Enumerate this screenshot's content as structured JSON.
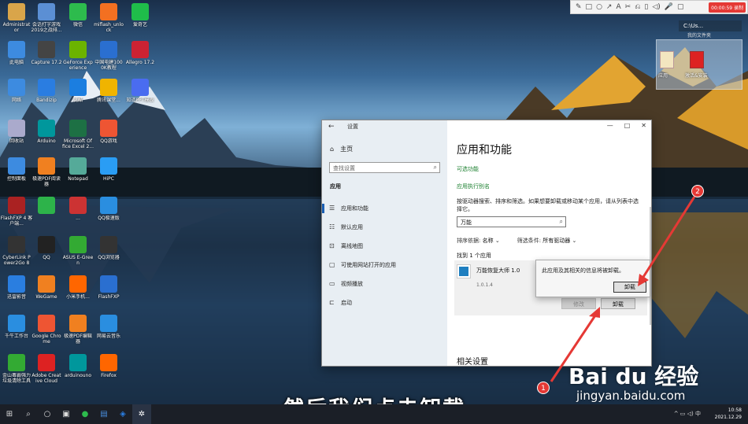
{
  "desktop": {
    "icons": [
      {
        "label": "Administrat or",
        "color": "#d9a54a"
      },
      {
        "label": "会话打字游戏 2019之战排...",
        "color": "#5b8fd4"
      },
      {
        "label": "微信",
        "color": "#2dbb4d"
      },
      {
        "label": "miflash_unlo ck",
        "color": "#f37021"
      },
      {
        "label": "爱奇艺",
        "color": "#1fbd4a"
      },
      {
        "label": "此电脑",
        "color": "#3d8be0"
      },
      {
        "label": "Capture 17.2",
        "color": "#444"
      },
      {
        "label": "GeForce Exp erience",
        "color": "#6bb300"
      },
      {
        "label": "中国电建100 0K教程",
        "color": "#2a6fd0"
      },
      {
        "label": "Allegro 17.2",
        "color": "#c23"
      },
      {
        "label": "网络",
        "color": "#3d8be0"
      },
      {
        "label": "Bandizip",
        "color": "#2a7de1"
      },
      {
        "label": "优酷",
        "color": "#1b7ee0"
      },
      {
        "label": "腾讯课堂...",
        "color": "#f0b400"
      },
      {
        "label": "知道PPT模板",
        "color": "#4a6cf0"
      },
      {
        "label": "回收站",
        "color": "#aac"
      },
      {
        "label": "Arduino",
        "color": "#00979c"
      },
      {
        "label": "Microsoft Of fice Excel 2...",
        "color": "#1d7044"
      },
      {
        "label": "QQ游戏",
        "color": "#e53"
      },
      {
        "label": "控制面板",
        "color": "#3d8be0"
      },
      {
        "label": "极速PDF阅读 器",
        "color": "#f08020"
      },
      {
        "label": "Notepad",
        "color": "#5a9"
      },
      {
        "label": "HiPC",
        "color": "#2a9df4"
      },
      {
        "label": "FlashFXP 4 客户端...",
        "color": "#a22"
      },
      {
        "label": "",
        "color": "#2db34a"
      },
      {
        "label": "...",
        "color": "#c33"
      },
      {
        "label": "QQ极速版",
        "color": "#2a8ee0"
      },
      {
        "label": "CyberLink P ower2Go 8",
        "color": "#333"
      },
      {
        "label": "QQ",
        "color": "#222"
      },
      {
        "label": "ASUS E-Gree n",
        "color": "#3a3"
      },
      {
        "label": "QQ浏览器",
        "color": "#333"
      },
      {
        "label": "迅雷影音",
        "color": "#2a7ee0"
      },
      {
        "label": "WeGame",
        "color": "#f08020"
      },
      {
        "label": "小米手机...",
        "color": "#f60"
      },
      {
        "label": "FlashFXP",
        "color": "#2a6fd0"
      },
      {
        "label": "千牛工作台",
        "color": "#2a8ee0"
      },
      {
        "label": "Google Chro me",
        "color": "#e53"
      },
      {
        "label": "极速PDF编辑 器",
        "color": "#f08020"
      },
      {
        "label": "网易云音乐",
        "color": "#2a8ee0"
      },
      {
        "label": "金山毒霸强力 垃圾清除工具",
        "color": "#3a3"
      },
      {
        "label": "Adobe Creat ive Cloud",
        "color": "#d22"
      },
      {
        "label": "arduinouno",
        "color": "#00979c"
      },
      {
        "label": "Firefox",
        "color": "#f60"
      }
    ],
    "folder_label": "我的文件夹",
    "folder_items": [
      "应用",
      "激活&安装"
    ],
    "top_right_label": "C:\\Us..."
  },
  "recorder": {
    "tools": [
      "✎",
      "□",
      "○",
      "↗",
      "A",
      "✂",
      "⎌",
      "▯",
      "◁)",
      "🎤",
      "▢"
    ],
    "rec_label": "00:00:59 录制"
  },
  "settings": {
    "title": "设置",
    "back": "←",
    "controls": [
      "—",
      "□",
      "✕"
    ],
    "home": "主页",
    "search_placeholder": "查找设置",
    "category": "应用",
    "nav": [
      {
        "label": "应用和功能",
        "icon": "☰"
      },
      {
        "label": "默认应用",
        "icon": "☷"
      },
      {
        "label": "离线地图",
        "icon": "⊡"
      },
      {
        "label": "可使用网站打开的应用",
        "icon": "▢"
      },
      {
        "label": "视频播放",
        "icon": "▭"
      },
      {
        "label": "启动",
        "icon": "⊏"
      }
    ],
    "page_title": "应用和功能",
    "link_optional": "可选功能",
    "link_alias": "应用执行别名",
    "description": "按驱动器搜索、排序和筛选。如果想要卸载或移动某个应用，请从列表中选择它。",
    "app_search_value": "万能",
    "sort_label": "排序依据:",
    "sort_value": "名称",
    "filter_label": "筛选条件:",
    "filter_value": "所有驱动器",
    "found": "找到 1 个应用",
    "app": {
      "name": "万能恢复大师 1.0",
      "version": "1.0.1.4"
    },
    "modify_label": "修改",
    "uninstall_label": "卸载",
    "related": "相关设置"
  },
  "popup": {
    "message": "此应用及其相关的信息将被卸载。",
    "button": "卸载"
  },
  "annotations": {
    "badge1": "1",
    "badge2": "2"
  },
  "subtitle": "然后我们点击卸载",
  "watermark": "Bai du 经验",
  "watermark_url": "jingyan.baidu.com",
  "taskbar": {
    "time": "10:58",
    "date": "2021.12.29",
    "tray": "^ ▭ ◁) 中"
  }
}
